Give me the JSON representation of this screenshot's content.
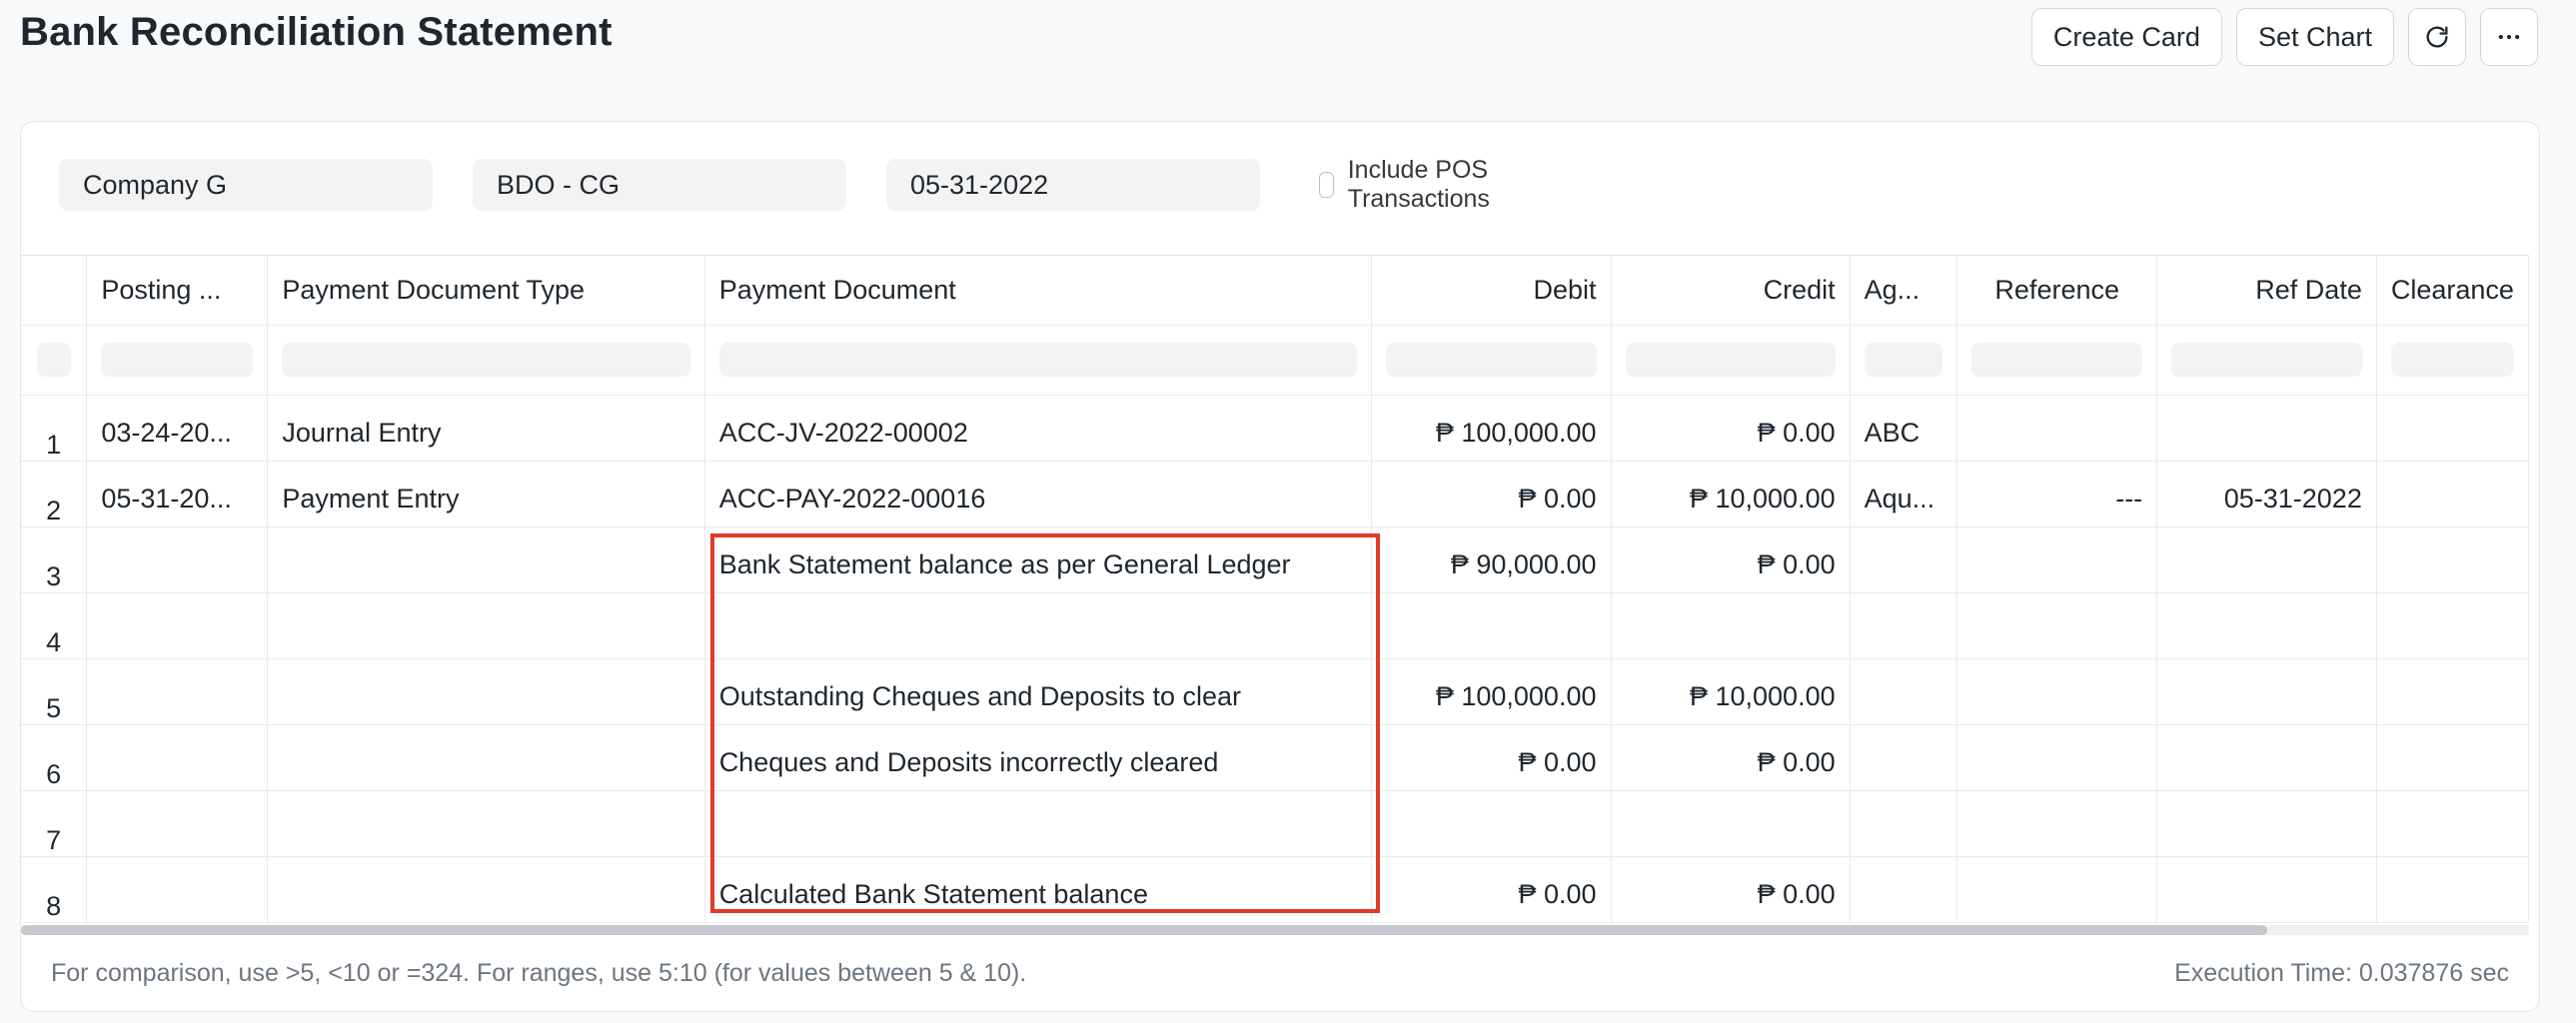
{
  "page": {
    "title": "Bank Reconciliation Statement"
  },
  "actions": {
    "create_card": "Create Card",
    "set_chart": "Set Chart",
    "refresh_icon": "refresh-icon",
    "more_icon": "more-icon"
  },
  "filters": {
    "company": "Company G",
    "account": "BDO - CG",
    "date": "05-31-2022",
    "include_pos_label": "Include POS Transactions",
    "include_pos_checked": false
  },
  "table": {
    "columns": [
      "Posting ...",
      "Payment Document Type",
      "Payment Document",
      "Debit",
      "Credit",
      "Ag...",
      "Reference",
      "Ref Date",
      "Clearance"
    ],
    "rows": [
      {
        "num": "1",
        "posting": "03-24-20...",
        "type": "Journal Entry",
        "doc": "ACC-JV-2022-00002",
        "debit": "₱ 100,000.00",
        "credit": "₱ 0.00",
        "against": "ABC",
        "reference": "",
        "ref_date": "",
        "clearance": ""
      },
      {
        "num": "2",
        "posting": "05-31-20...",
        "type": "Payment Entry",
        "doc": "ACC-PAY-2022-00016",
        "debit": "₱ 0.00",
        "credit": "₱ 10,000.00",
        "against": "Aqu...",
        "reference": "---",
        "ref_date": "05-31-2022",
        "clearance": ""
      },
      {
        "num": "3",
        "posting": "",
        "type": "",
        "doc": "Bank Statement balance as per General Ledger",
        "debit": "₱ 90,000.00",
        "credit": "₱ 0.00",
        "against": "",
        "reference": "",
        "ref_date": "",
        "clearance": ""
      },
      {
        "num": "4",
        "posting": "",
        "type": "",
        "doc": "",
        "debit": "",
        "credit": "",
        "against": "",
        "reference": "",
        "ref_date": "",
        "clearance": ""
      },
      {
        "num": "5",
        "posting": "",
        "type": "",
        "doc": "Outstanding Cheques and Deposits to clear",
        "debit": "₱ 100,000.00",
        "credit": "₱ 10,000.00",
        "against": "",
        "reference": "",
        "ref_date": "",
        "clearance": ""
      },
      {
        "num": "6",
        "posting": "",
        "type": "",
        "doc": "Cheques and Deposits incorrectly cleared",
        "debit": "₱ 0.00",
        "credit": "₱ 0.00",
        "against": "",
        "reference": "",
        "ref_date": "",
        "clearance": ""
      },
      {
        "num": "7",
        "posting": "",
        "type": "",
        "doc": "",
        "debit": "",
        "credit": "",
        "against": "",
        "reference": "",
        "ref_date": "",
        "clearance": ""
      },
      {
        "num": "8",
        "posting": "",
        "type": "",
        "doc": "Calculated Bank Statement balance",
        "debit": "₱ 0.00",
        "credit": "₱ 0.00",
        "against": "",
        "reference": "",
        "ref_date": "",
        "clearance": ""
      }
    ]
  },
  "footer": {
    "note": "For comparison, use >5, <10 or =324. For ranges, use 5:10 (for values between 5 & 10).",
    "execution_time": "Execution Time: 0.037876 sec"
  },
  "colors": {
    "highlight": "#e03a28"
  }
}
